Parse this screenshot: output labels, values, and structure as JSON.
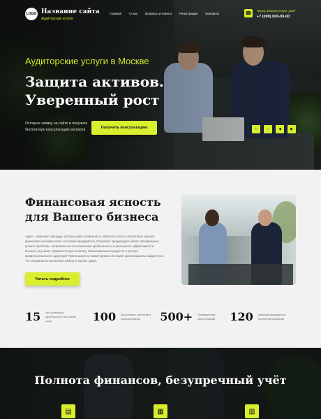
{
  "header": {
    "logo_text": "LOGO",
    "site_name": "Название сайта",
    "site_subtitle": "Аудиторские услуги",
    "nav": [
      "Главная",
      "О нас",
      "Вопросы и ответы",
      "Регистрация",
      "Контакты"
    ],
    "callback_label": "Перед звонком услуги, дом?",
    "phone": "+7 (000) 000-00-00",
    "phone_icon": "phone-icon"
  },
  "hero": {
    "kicker": "Аудиторские услуги в Москве",
    "title": "Защита активов. Уверенный рост",
    "note": "Оставьте заявку на сайте и получите бесплатную консультацию эксперта",
    "cta": "Получить консультацию",
    "arrows": [
      "‹",
      "›",
      "◀",
      "▶"
    ]
  },
  "about": {
    "title": "Финансовая ясность для Вашего бизнеса",
    "text": "Аудит – комплекс процедур, которые дают возможность наиболее полно и объективно оценить финансово-экономическое состояние предприятия. Позволяет предупредить и/или своевременно решить проблемы, направленные на повышение прибыльности и увеличение эффективности бизнеса, улучшает управленческую политику. Ваша компания нуждается в услугах профессионального аудитора? Приглашаем на новый уровень! В нашей организации вы найдете все, что специалисты выполняют работу в сжатые сроки.",
    "cta": "Читать подробнее",
    "stats": [
      {
        "num": "15",
        "label": "лет успешной деятельности на рынке услуг"
      },
      {
        "num": "100",
        "label": "постоянных клиентов и корпоративных"
      },
      {
        "num": "500+",
        "label": "Проведенных консультаций"
      },
      {
        "num": "120",
        "label": "специализированных экспертов компании"
      }
    ]
  },
  "services": {
    "title": "Полнота финансов, безупречный учёт",
    "icons": [
      "document-icon",
      "calculator-icon",
      "chart-icon"
    ]
  },
  "colors": {
    "accent": "#d8ee2e",
    "dark": "#151917",
    "light_bg": "#f2f2f2"
  }
}
